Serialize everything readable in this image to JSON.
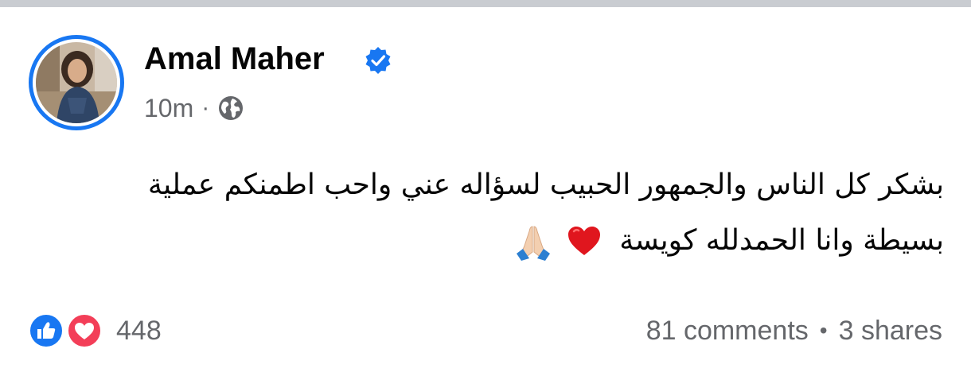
{
  "post": {
    "author": "Amal Maher",
    "verified": true,
    "timestamp": "10m",
    "meta_separator": "·",
    "audience_icon": "globe-icon",
    "text_line1": "بشكر كل الناس والجمهور الحبيب لسؤاله عني واحب اطمنكم عملية",
    "text_line2": "بسيطة وانا الحمدلله كويسة",
    "emojis": [
      "red-heart-emoji",
      "folded-hands-emoji"
    ]
  },
  "footer": {
    "reaction_icons": [
      "like-icon",
      "love-icon"
    ],
    "reaction_count": "448",
    "comments": "81 comments",
    "separator": "•",
    "shares": "3 shares"
  },
  "colors": {
    "brand_blue": "#1877f2",
    "love_red": "#f33e58",
    "secondary_text": "#65676b",
    "primary_text": "#050505"
  }
}
